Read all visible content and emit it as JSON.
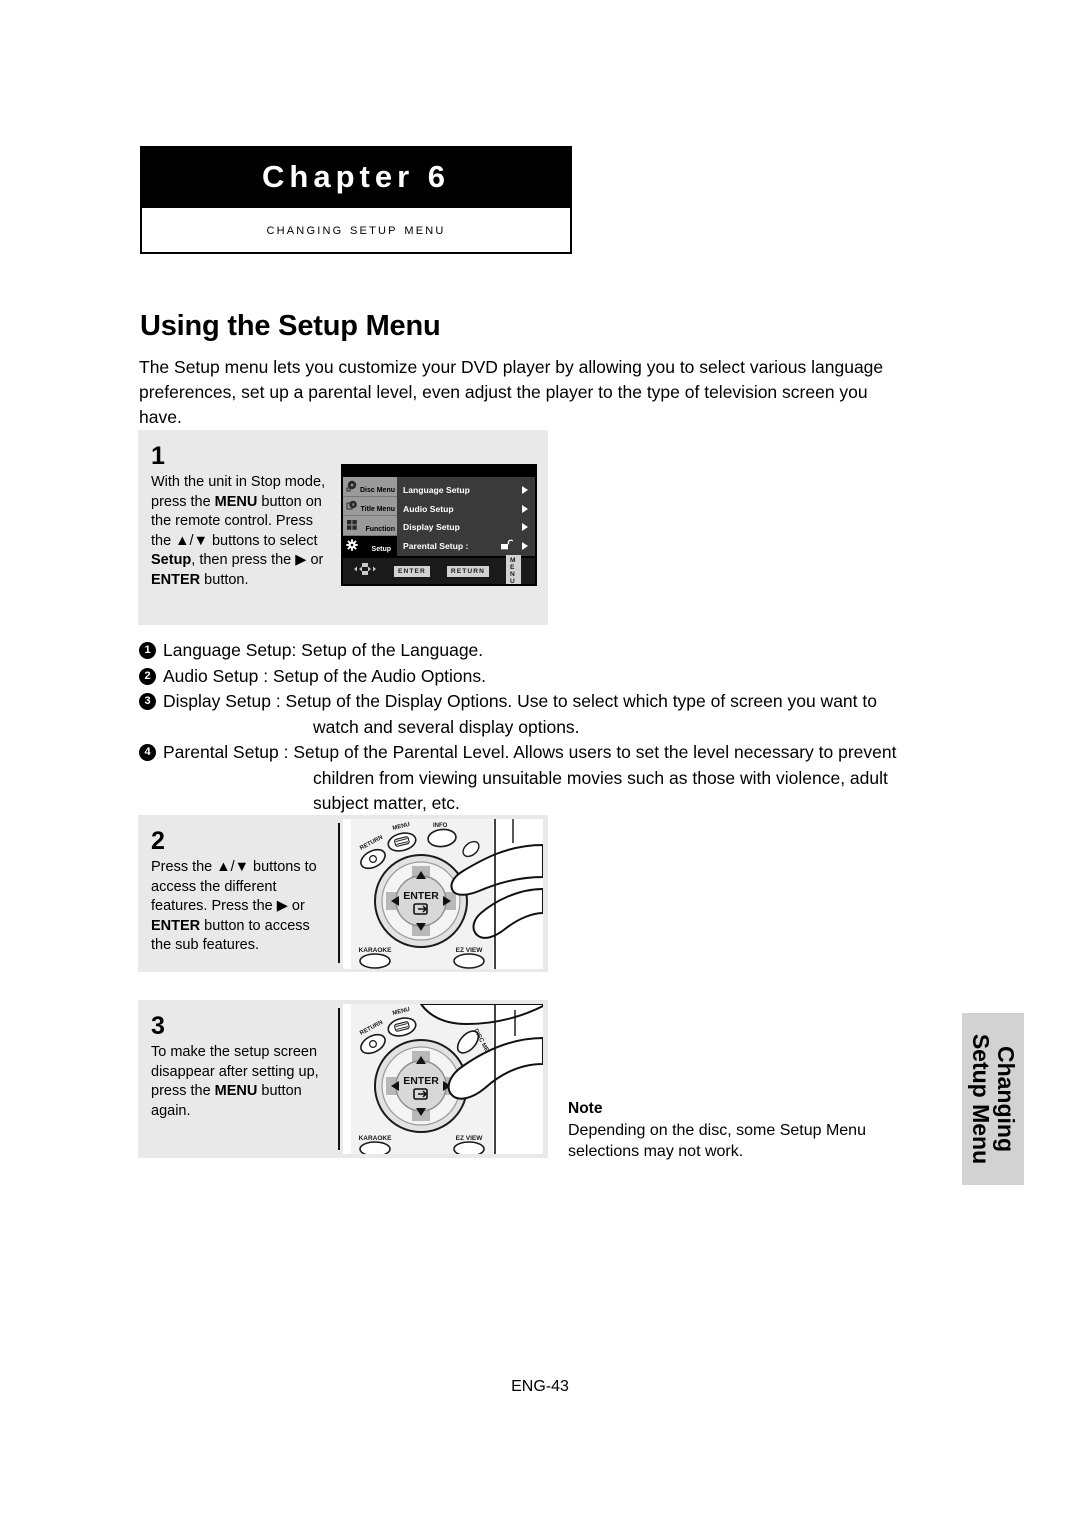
{
  "chapter": {
    "title": "Chapter 6",
    "subtitle": "Changing Setup Menu"
  },
  "heading": "Using the Setup Menu",
  "intro": "The Setup menu lets you customize your DVD player by allowing you to select various language preferences, set up a parental level, even adjust the player to the type of television screen you have.",
  "steps": [
    {
      "number": "1",
      "text_parts": [
        {
          "t": "With the unit in Stop mode, press the ",
          "b": false
        },
        {
          "t": "MENU",
          "b": true
        },
        {
          "t": " button on the remote control. Press the ▲/▼ buttons to select ",
          "b": false
        },
        {
          "t": "Setup",
          "b": true
        },
        {
          "t": ", then press the ▶ or ",
          "b": false
        },
        {
          "t": "ENTER",
          "b": true
        },
        {
          "t": " button.",
          "b": false
        }
      ]
    },
    {
      "number": "2",
      "text_parts": [
        {
          "t": "Press the ▲/▼ buttons to access the different features. Press the ▶ or ",
          "b": false
        },
        {
          "t": "ENTER",
          "b": true
        },
        {
          "t": " button to access the sub features.",
          "b": false
        }
      ]
    },
    {
      "number": "3",
      "text_parts": [
        {
          "t": "To make the setup screen disappear after setting up, press the ",
          "b": false
        },
        {
          "t": "MENU",
          "b": true
        },
        {
          "t": " button again.",
          "b": false
        }
      ]
    }
  ],
  "osd": {
    "sidebar": [
      {
        "label": "Disc Menu",
        "icon": "disc-menu-icon",
        "active": false
      },
      {
        "label": "Title Menu",
        "icon": "title-menu-icon",
        "active": false
      },
      {
        "label": "Function",
        "icon": "function-icon",
        "active": false
      },
      {
        "label": "Setup",
        "icon": "gear-icon",
        "active": true
      }
    ],
    "rows": [
      {
        "label": "Language Setup",
        "lock": false
      },
      {
        "label": "Audio Setup",
        "lock": false
      },
      {
        "label": "Display Setup",
        "lock": false
      },
      {
        "label": "Parental Setup :",
        "lock": true
      }
    ],
    "buttons": [
      "ENTER",
      "RETURN",
      "M E N U"
    ]
  },
  "remote": {
    "labels": {
      "return": "RETURN",
      "menu": "MENU",
      "info": "INFO",
      "disc_menu": "DISC MENU",
      "enter": "ENTER",
      "karaoke": "KARAOKE",
      "ez_view": "EZ VIEW"
    }
  },
  "list": [
    {
      "num": "❶",
      "text": "Language Setup: Setup of the Language.",
      "cont": ""
    },
    {
      "num": "❷",
      "text": "Audio Setup : Setup of the Audio Options.",
      "cont": ""
    },
    {
      "num": "❸",
      "text": "Display Setup : Setup of the Display Options. Use to select which type of screen you want to",
      "cont": "watch and several display options."
    },
    {
      "num": "❹",
      "text": "Parental Setup : Setup of the Parental Level. Allows users to set the level necessary to prevent",
      "cont": "children from viewing unsuitable movies such as those with violence, adult subject matter, etc."
    }
  ],
  "note": {
    "title": "Note",
    "text": "Depending on the disc, some Setup Menu selections may not work."
  },
  "side_tab": {
    "line1": "Changing",
    "line2": "Setup Menu"
  },
  "footer": "ENG-43"
}
